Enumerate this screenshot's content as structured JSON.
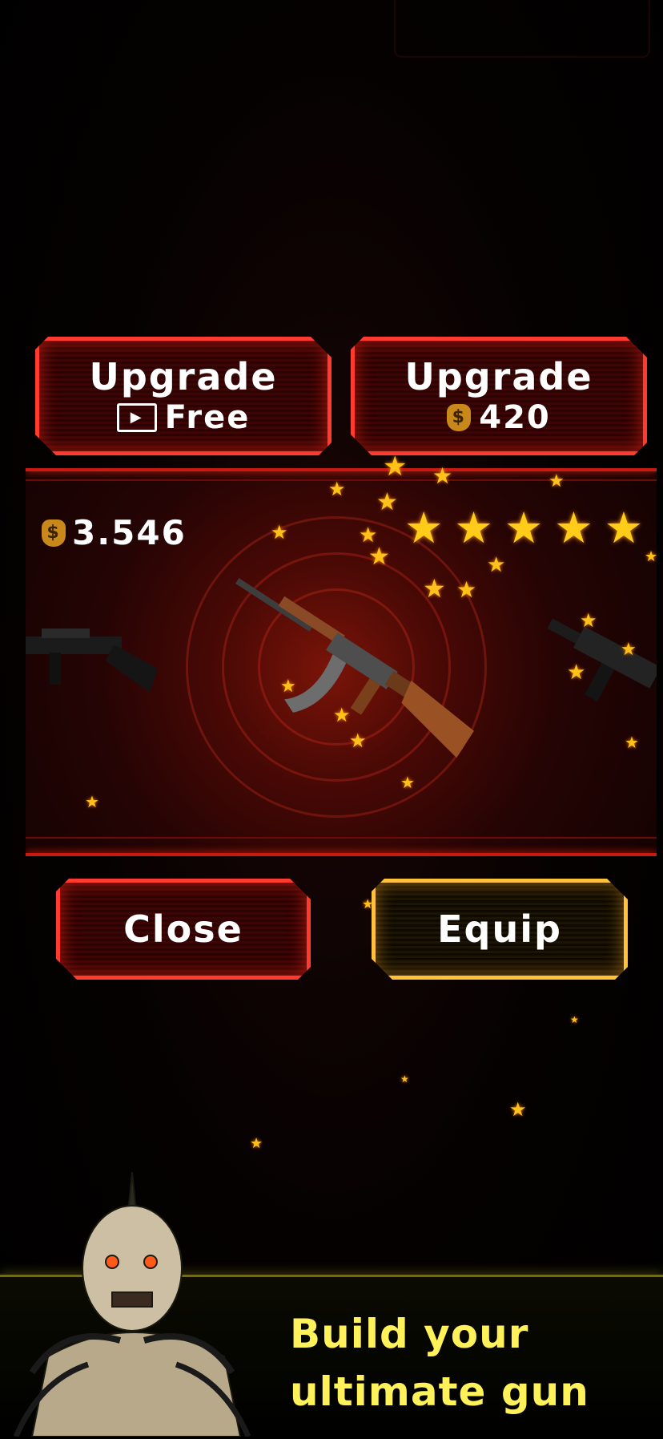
{
  "upgrade_video": {
    "title": "Upgrade",
    "price": "Free",
    "icon": "video-ad-icon"
  },
  "upgrade_coins": {
    "title": "Upgrade",
    "price": "420",
    "icon": "money-bag-icon"
  },
  "balance": {
    "amount": "3.546",
    "icon": "money-bag-icon"
  },
  "weapon": {
    "rating_stars": 5
  },
  "actions": {
    "close": "Close",
    "equip": "Equip"
  },
  "promo": {
    "line1": "Build your",
    "line2": "ultimate gun"
  },
  "colors": {
    "red_frame": "#ff3b2f",
    "gold_frame": "#ffc23a",
    "tagline": "#fff15a",
    "star": "#ffc21a"
  }
}
